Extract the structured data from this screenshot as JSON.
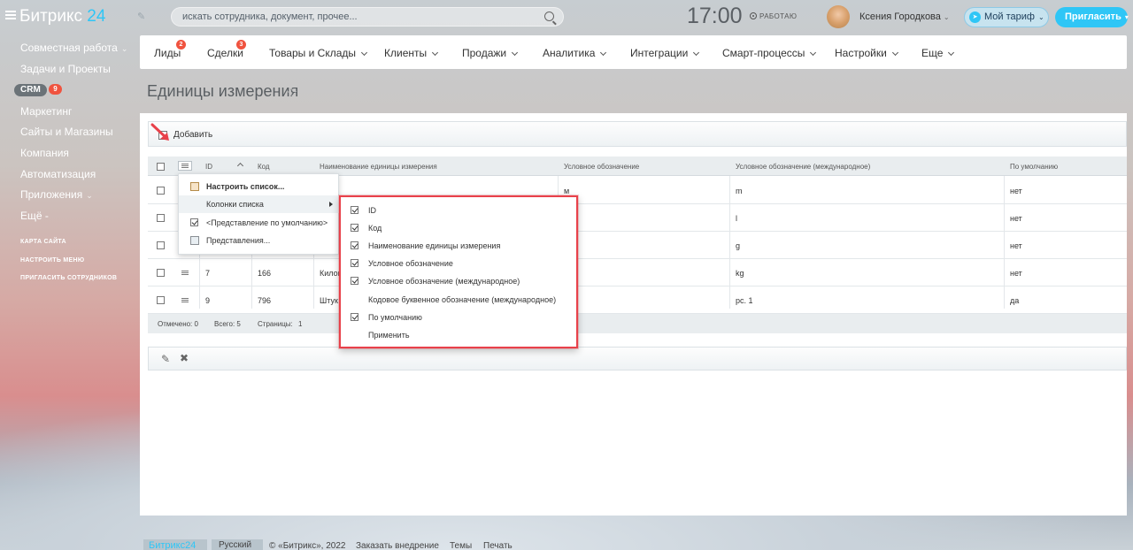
{
  "header": {
    "logo_text": "Битрикс",
    "logo_num": "24",
    "search_placeholder": "искать сотрудника, документ, прочее...",
    "clock": "17:00",
    "work_status": "РАБОТАЮ",
    "user_name": "Ксения Городкова",
    "tariff_label": "Мой тариф",
    "invite_label": "Пригласить"
  },
  "sidebar": {
    "items": [
      {
        "label": "Совместная работа",
        "has_caret": true
      },
      {
        "label": "Задачи и Проекты"
      },
      {
        "label": "CRM",
        "badge": "9"
      },
      {
        "label": "Маркетинг"
      },
      {
        "label": "Сайты и Магазины"
      },
      {
        "label": "Компания"
      },
      {
        "label": "Автоматизация"
      },
      {
        "label": "Приложения",
        "has_caret": true
      },
      {
        "label": "Ещё -"
      }
    ],
    "links": [
      "КАРТА САЙТА",
      "НАСТРОИТЬ МЕНЮ",
      "ПРИГЛАСИТЬ СОТРУДНИКОВ"
    ]
  },
  "topnav": {
    "items": [
      {
        "label": "Лиды",
        "badge": "2"
      },
      {
        "label": "Сделки",
        "badge": "3"
      },
      {
        "label": "Товары и Склады"
      },
      {
        "label": "Клиенты"
      },
      {
        "label": "Продажи"
      },
      {
        "label": "Аналитика"
      },
      {
        "label": "Интеграции"
      },
      {
        "label": "Смарт-процессы"
      },
      {
        "label": "Настройки"
      },
      {
        "label": "Еще"
      }
    ]
  },
  "page": {
    "title": "Единицы измерения",
    "add_label": "Добавить"
  },
  "grid": {
    "columns": [
      "ID",
      "Код",
      "Наименование единицы измерения",
      "Условное обозначение",
      "Условное обозначение (международное)",
      "По умолчанию"
    ],
    "rows": [
      {
        "id": "",
        "code": "",
        "name": "",
        "symbol": "м",
        "intl": "m",
        "default": "нет"
      },
      {
        "id": "",
        "code": "",
        "name": "",
        "symbol": "",
        "intl": "l",
        "default": "нет"
      },
      {
        "id": "",
        "code": "",
        "name": "",
        "symbol": "",
        "intl": "g",
        "default": "нет"
      },
      {
        "id": "7",
        "code": "166",
        "name": "Килог",
        "symbol": "",
        "intl": "kg",
        "default": "нет"
      },
      {
        "id": "9",
        "code": "796",
        "name": "Штук",
        "symbol": "",
        "intl": "pc. 1",
        "default": "да"
      }
    ],
    "footer": {
      "selected": "Отмечено: 0",
      "total": "Всего: 5",
      "pages": "Страницы:",
      "page_num": "1"
    }
  },
  "context_menu": {
    "items": [
      "Настроить список...",
      "Колонки списка",
      "<Представление по умолчанию>",
      "Представления..."
    ]
  },
  "columns_menu": {
    "items": [
      {
        "label": "ID",
        "checked": true
      },
      {
        "label": "Код",
        "checked": true
      },
      {
        "label": "Наименование единицы измерения",
        "checked": true
      },
      {
        "label": "Условное обозначение",
        "checked": true
      },
      {
        "label": "Условное обозначение (международное)",
        "checked": true
      },
      {
        "label": "Кодовое буквенное обозначение (международное)",
        "checked": false
      },
      {
        "label": "По умолчанию",
        "checked": true
      },
      {
        "label": "Применить",
        "checked": false,
        "action": true
      }
    ]
  },
  "site_footer": {
    "logo": "Битрикс24",
    "lang": "Русский",
    "copyright": "© «Битрикс», 2022",
    "order": "Заказать внедрение",
    "themes": "Темы",
    "print": "Печать"
  },
  "colors": {
    "accent": "#2fc6f6",
    "badge": "#f0533f",
    "highlight_border": "#e8414a"
  }
}
